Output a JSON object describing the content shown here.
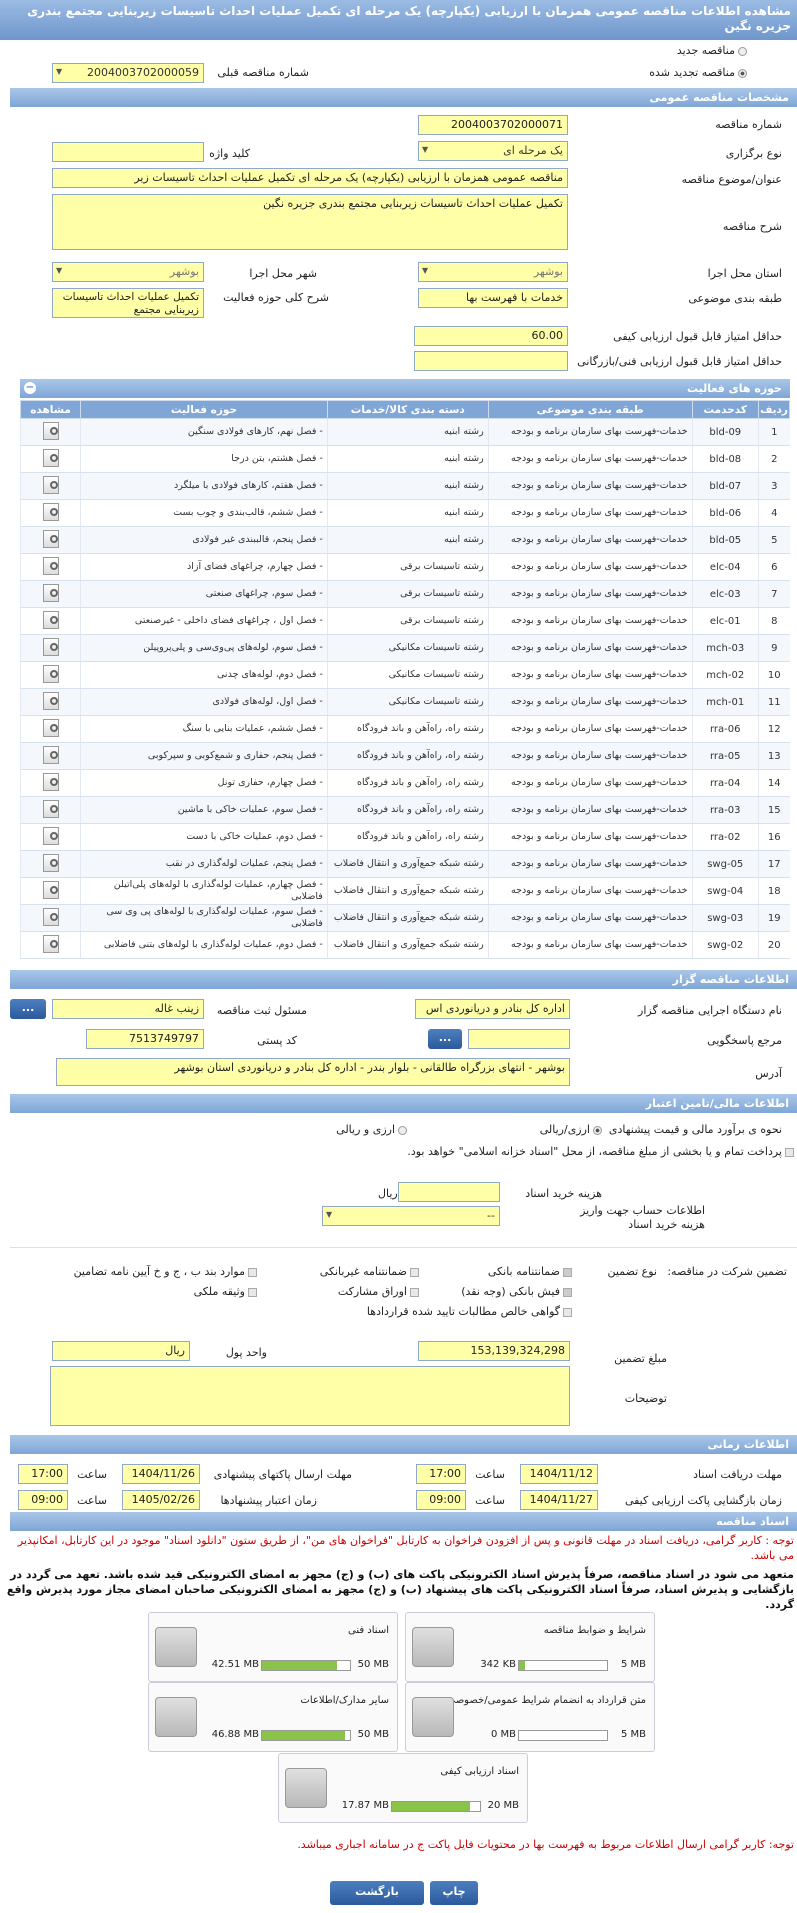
{
  "header": {
    "title": "مشاهده اطلاعات مناقصه عمومی همزمان با ارزیابی (یکپارچه) یک مرحله ای تکمیل عملیات احداث تاسیسات زیربنایی مجتمع بندری جزیره نگین"
  },
  "tender_type": {
    "new_label": "مناقصه جدید",
    "renewed_label": "مناقصه تجدید شده",
    "prev_label": "شماره مناقصه قبلی",
    "prev_value": "2004003702000059"
  },
  "general": {
    "section": "مشخصات مناقصه عمومی",
    "number_label": "شماره مناقصه",
    "number": "2004003702000071",
    "type_label": "نوع برگزاری",
    "type": "یک مرحله ای",
    "keyword_label": "کلید واژه",
    "keyword": "",
    "title_label": "عنوان/موضوع مناقصه",
    "title": "مناقصه عمومی همزمان با ارزیابی (یکپارچه) یک مرحله ای تکمیل عملیات احداث تاسیسات زیر",
    "desc_label": "شرح مناقصه",
    "desc": "تکمیل عملیات احداث تاسیسات زیربنایی مجتمع بندری جزیره نگین",
    "province_label": "استان محل اجرا",
    "province": "بوشهر",
    "city_label": "شهر محل اجرا",
    "city": "بوشهر",
    "category_label": "طبقه بندی موضوعی",
    "category": "خدمات با فهرست بها",
    "scope_label": "شرح کلی حوزه فعالیت",
    "scope": "تکمیل عملیات احداث تاسیسات زیربنایی مجتمع",
    "min_quality_label": "حداقل امتیاز قابل قبول ارزیابی کیفی",
    "min_quality": "60.00",
    "min_tech_label": "حداقل امتیاز قابل قبول ارزیابی فنی/بازرگانی",
    "min_tech": ""
  },
  "activity": {
    "section": "حوزه های فعالیت",
    "columns": [
      "ردیف",
      "کدحدمت",
      "طبقه بندی موضوعی",
      "دسته بندی کالا/خدمات",
      "حوزه فعالیت",
      "مشاهده"
    ],
    "rows": [
      [
        "1",
        "bld-09",
        "خدمات-فهرست بهای سازمان برنامه و بودجه",
        "رشته ابنیه",
        "- فصل نهم، کارهای فولادی سنگین"
      ],
      [
        "2",
        "bld-08",
        "خدمات-فهرست بهای سازمان برنامه و بودجه",
        "رشته ابنیه",
        "- فصل هشتم، بتن درجا"
      ],
      [
        "3",
        "bld-07",
        "خدمات-فهرست بهای سازمان برنامه و بودجه",
        "رشته ابنیه",
        "- فصل هفتم، کارهای فولادی با میلگرد"
      ],
      [
        "4",
        "bld-06",
        "خدمات-فهرست بهای سازمان برنامه و بودجه",
        "رشته ابنیه",
        "- فصل ششم، قالب‌بندی و چوب بست"
      ],
      [
        "5",
        "bld-05",
        "خدمات-فهرست بهای سازمان برنامه و بودجه",
        "رشته ابنیه",
        "- فصل پنجم، قالببندی غیر فولادی"
      ],
      [
        "6",
        "elc-04",
        "خدمات-فهرست بهای سازمان برنامه و بودجه",
        "رشته تاسیسات برقی",
        "- فصل چهارم، چراغهای فضای آزاد"
      ],
      [
        "7",
        "elc-03",
        "خدمات-فهرست بهای سازمان برنامه و بودجه",
        "رشته تاسیسات برقی",
        "- فصل سوم، چراغهای صنعتی"
      ],
      [
        "8",
        "elc-01",
        "خدمات-فهرست بهای سازمان برنامه و بودجه",
        "رشته تاسیسات برقی",
        "- فصل اول ، چراغهای فضای داخلی - غیرصنعتی"
      ],
      [
        "9",
        "mch-03",
        "خدمات-فهرست بهای سازمان برنامه و بودجه",
        "رشته تاسیسات مکانیکی",
        "- فصل سوم، لوله‌های پی‌وی‌سی و پلی‌پروپیلن"
      ],
      [
        "10",
        "mch-02",
        "خدمات-فهرست بهای سازمان برنامه و بودجه",
        "رشته تاسیسات مکانیکی",
        "- فصل دوم، لوله‌های چدنی"
      ],
      [
        "11",
        "mch-01",
        "خدمات-فهرست بهای سازمان برنامه و بودجه",
        "رشته تاسیسات مکانیکی",
        "- فصل اول، لوله‌های فولادی"
      ],
      [
        "12",
        "rra-06",
        "خدمات-فهرست بهای سازمان برنامه و بودجه",
        "رشته راه، راه‌آهن و باند فرودگاه",
        "- فصل ششم، عملیات بنایی با سنگ"
      ],
      [
        "13",
        "rra-05",
        "خدمات-فهرست بهای سازمان برنامه و بودجه",
        "رشته راه، راه‌آهن و باند فرودگاه",
        "- فصل پنجم، حفاری و شمع‌کوبی و سپرکوبی"
      ],
      [
        "14",
        "rra-04",
        "خدمات-فهرست بهای سازمان برنامه و بودجه",
        "رشته راه، راه‌آهن و باند فرودگاه",
        "- فصل چهارم، حفاری تونل"
      ],
      [
        "15",
        "rra-03",
        "خدمات-فهرست بهای سازمان برنامه و بودجه",
        "رشته راه، راه‌آهن و باند فرودگاه",
        "- فصل سوم، عملیات خاکی با ماشین"
      ],
      [
        "16",
        "rra-02",
        "خدمات-فهرست بهای سازمان برنامه و بودجه",
        "رشته راه، راه‌آهن و باند فرودگاه",
        "- فصل دوم، عملیات خاکی با دست"
      ],
      [
        "17",
        "swg-05",
        "خدمات-فهرست بهای سازمان برنامه و بودجه",
        "رشته شبکه جمع‌آوری و انتقال فاضلاب",
        "- فصل پنجم، عملیات لوله‌گذاری در نقب"
      ],
      [
        "18",
        "swg-04",
        "خدمات-فهرست بهای سازمان برنامه و بودجه",
        "رشته شبکه جمع‌آوری و انتقال فاضلاب",
        "- فصل چهارم، عملیات لوله‌گذاری با لوله‌های پلی‌اتیلن فاضلابی"
      ],
      [
        "19",
        "swg-03",
        "خدمات-فهرست بهای سازمان برنامه و بودجه",
        "رشته شبکه جمع‌آوری و انتقال فاضلاب",
        "- فصل سوم، عملیات لوله‌گذاری با لوله‌های پی وی سی فاضلابی"
      ],
      [
        "20",
        "swg-02",
        "خدمات-فهرست بهای سازمان برنامه و بودجه",
        "رشته شبکه جمع‌آوری و انتقال فاضلاب",
        "- فصل دوم، عملیات لوله‌گذاری با لوله‌های بتنی فاضلابی"
      ]
    ]
  },
  "organizer": {
    "section": "اطلاعات مناقصه گزار",
    "org_label": "نام دستگاه اجرایی مناقصه گزار",
    "org": "اداره کل بنادر و دریانوردی اس",
    "resp_label": "مسئول ثبت مناقصه",
    "resp": "زینب غاله",
    "ref_label": "مرجع پاسخگویی",
    "ref": "",
    "postal_label": "کد پستی",
    "postal": "7513749797",
    "addr_label": "آدرس",
    "addr": "بوشهر - انتهای بزرگراه طالقانی - بلوار بندر - اداره کل بنادر و دریانوردی استان بوشهر",
    "more_btn": "..."
  },
  "finance": {
    "section": "اطلاعات مالی/تامین اعتبار",
    "method_label": "نحوه ی برآورد مالی و قیمت پیشنهادی",
    "opt1": "ارزی/ریالی",
    "opt2": "ارزی و ریالی",
    "treasury_text": "پرداخت تمام و یا بخشی از مبلغ مناقصه، از محل \"اسناد خزانه اسلامی\" خواهد بود.",
    "doc_fee_label": "هزینه خرید اسناد",
    "doc_fee": "",
    "doc_fee_unit": "ریال",
    "account_label": "اطلاعات حساب جهت واریز هزینه خرید اسناد",
    "account": "--"
  },
  "guarantee": {
    "label": "تضمین شرکت در مناقصه:",
    "type_label": "نوع تضمین",
    "items": [
      "ضمانتنامه بانکی",
      "ضمانتنامه غیربانکی",
      "موارد بند ب ، ج و خ آیین نامه تضامین",
      "فیش بانکی (وجه نقد)",
      "اوراق مشارکت",
      "وثیقه ملکی",
      "گواهی خالص مطالبات تایید شده قراردادها"
    ],
    "amount_label": "مبلغ تضمین",
    "amount": "153,139,324,298",
    "currency_label": "واحد پول",
    "currency": "ریال",
    "notes_label": "توضیحات",
    "notes": ""
  },
  "timing": {
    "section": "اطلاعات زمانی",
    "doc_recv_label": "مهلت دریافت اسناد",
    "doc_recv_date": "1404/11/12",
    "doc_recv_time": "17:00",
    "submit_label": "مهلت ارسال پاکتهای پیشنهادی",
    "submit_date": "1404/11/26",
    "submit_time": "17:00",
    "open_label": "زمان بازگشایی پاکت ارزیابی کیفی",
    "open_date": "1404/11/27",
    "open_time": "09:00",
    "valid_label": "زمان اعتبار پیشنهادها",
    "valid_date": "1405/02/26",
    "valid_time": "09:00",
    "time_label": "ساعت"
  },
  "documents": {
    "section": "اسناد مناقصه",
    "note1": "توجه : کاربر گرامی، دریافت اسناد در مهلت قانونی و پس از افزودن فراخوان به کارتابل \"فراخوان های من\"، از طریق ستون \"دانلود اسناد\" موجود در این کارتابل، امکانپذیر می باشد.",
    "note2": "متعهد می شود در اسناد مناقصه، صرفاً پذیرش اسناد الکترونیکی پاکت های (ب) و (ج) مجهز به امضای الکترونیکی قید شده باشد. تعهد می گردد در بازگشایی و پذیرش اسناد، صرفاً اسناد الکترونیکی پاکت های پیشنهاد (ب) و (ج) مجهز به امضای الکترونیکی صاحبان امضای مجاز مورد پذیرش واقع گردد.",
    "files": [
      {
        "name": "شرایط و ضوابط مناقصه",
        "size": "342 KB",
        "max": "5 MB",
        "fill": 0.07
      },
      {
        "name": "اسناد فنی",
        "size": "42.51 MB",
        "max": "50 MB",
        "fill": 0.85
      },
      {
        "name": "متن قرارداد به انضمام شرایط عمومی/خصوصی",
        "size": "0 MB",
        "max": "5 MB",
        "fill": 0.0
      },
      {
        "name": "سایر مدارک/اطلاعات",
        "size": "46.88 MB",
        "max": "50 MB",
        "fill": 0.94
      },
      {
        "name": "اسناد ارزیابی کیفی",
        "size": "17.87 MB",
        "max": "20 MB",
        "fill": 0.89
      }
    ],
    "note3": "توجه: کاربر گرامی ارسال اطلاعات مربوط به فهرست بها در محتویات فایل پاکت ج در سامانه اجباری میباشد."
  },
  "footer": {
    "print": "چاپ",
    "back": "بازگشت"
  },
  "colors": {
    "section_bar": "#7fa6d6",
    "field_bg": "#ffffa8",
    "progress": "#8bc34a",
    "note_red": "#cc0000"
  }
}
